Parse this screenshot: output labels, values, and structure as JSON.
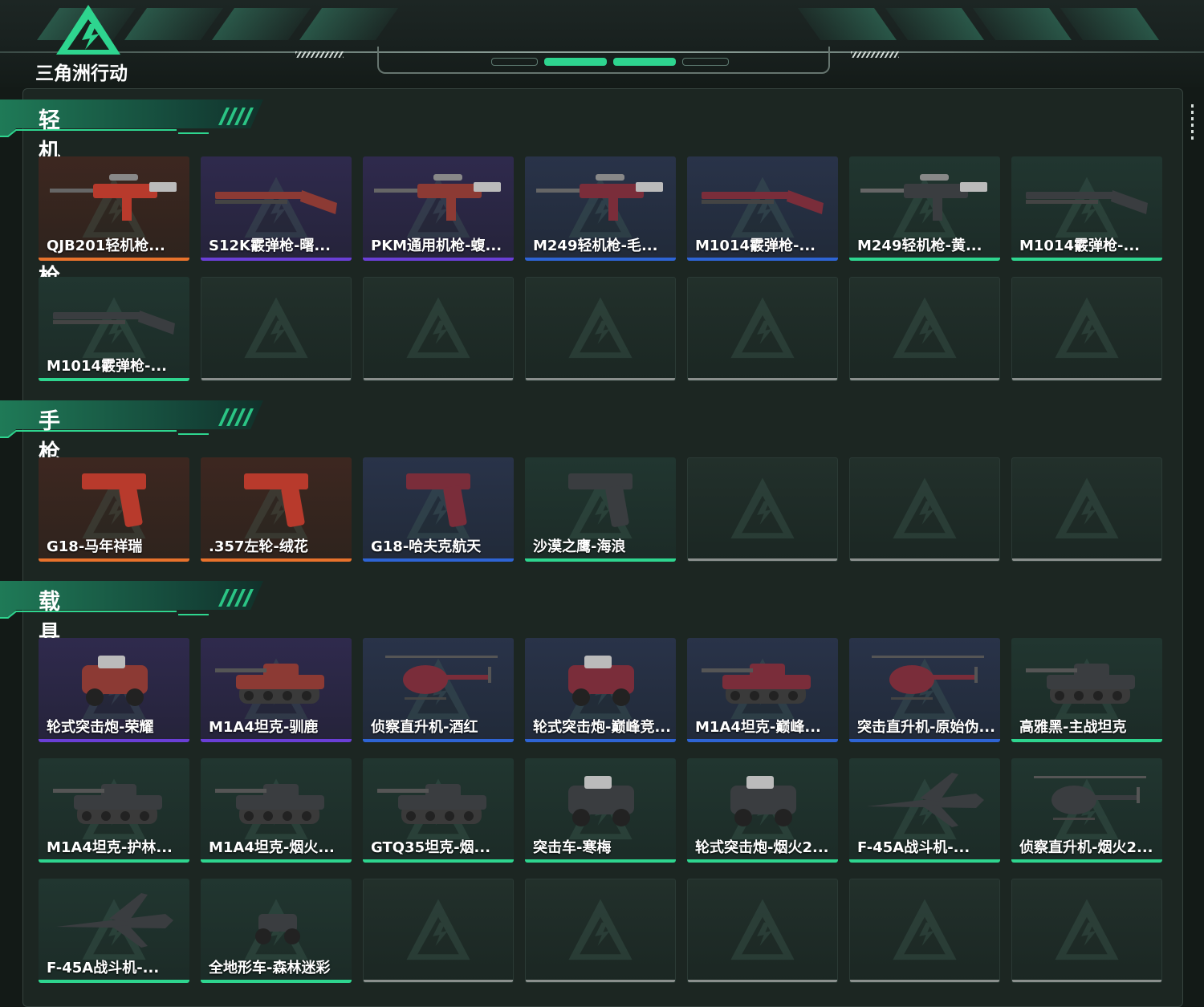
{
  "brand": {
    "logo_text": "三角洲行动",
    "accent": "#2ed58f"
  },
  "rarity_colors": {
    "orange": "#e8722c",
    "purple": "#6a3fd6",
    "blue": "#2e64d4",
    "green": "#2ed58f",
    "empty": "#8a8f8d"
  },
  "sections": [
    {
      "title": "轻机枪/霰弹枪",
      "items": [
        {
          "name": "QJB201轻机枪...",
          "rarity": "orange",
          "icon": "lmg-icon"
        },
        {
          "name": "S12K霰弹枪-曙...",
          "rarity": "purple",
          "icon": "shotgun-icon"
        },
        {
          "name": "PKM通用机枪-蝮...",
          "rarity": "purple",
          "icon": "machine-gun-icon"
        },
        {
          "name": "M249轻机枪-毛...",
          "rarity": "blue",
          "icon": "lmg-icon"
        },
        {
          "name": "M1014霰弹枪-...",
          "rarity": "blue",
          "icon": "shotgun-icon"
        },
        {
          "name": "M249轻机枪-黄...",
          "rarity": "green",
          "icon": "lmg-icon"
        },
        {
          "name": "M1014霰弹枪-...",
          "rarity": "green",
          "icon": "shotgun-icon"
        },
        {
          "name": "M1014霰弹枪-...",
          "rarity": "green",
          "icon": "shotgun-icon"
        }
      ],
      "empty_slots": 6
    },
    {
      "title": "手枪",
      "items": [
        {
          "name": "G18-马年祥瑞",
          "rarity": "orange",
          "icon": "pistol-icon"
        },
        {
          "name": ".357左轮-绒花",
          "rarity": "orange",
          "icon": "revolver-icon"
        },
        {
          "name": "G18-哈夫克航天",
          "rarity": "blue",
          "icon": "pistol-icon"
        },
        {
          "name": "沙漠之鹰-海浪",
          "rarity": "green",
          "icon": "pistol-icon"
        }
      ],
      "empty_slots": 3
    },
    {
      "title": "载具外观",
      "items": [
        {
          "name": "轮式突击炮-荣耀",
          "rarity": "purple",
          "icon": "armored-car-icon"
        },
        {
          "name": "M1A4坦克-驯鹿",
          "rarity": "purple",
          "icon": "tank-icon"
        },
        {
          "name": "侦察直升机-酒红",
          "rarity": "blue",
          "icon": "helicopter-icon"
        },
        {
          "name": "轮式突击炮-巅峰竞...",
          "rarity": "blue",
          "icon": "armored-car-icon"
        },
        {
          "name": "M1A4坦克-巅峰...",
          "rarity": "blue",
          "icon": "tank-icon"
        },
        {
          "name": "突击直升机-原始伪...",
          "rarity": "blue",
          "icon": "attack-helicopter-icon"
        },
        {
          "name": "高雅黑-主战坦克",
          "rarity": "green",
          "icon": "tank-icon"
        },
        {
          "name": "M1A4坦克-护林...",
          "rarity": "green",
          "icon": "tank-icon"
        },
        {
          "name": "M1A4坦克-烟火...",
          "rarity": "green",
          "icon": "tank-icon"
        },
        {
          "name": "GTQ35坦克-烟...",
          "rarity": "green",
          "icon": "tank-icon"
        },
        {
          "name": "突击车-寒梅",
          "rarity": "green",
          "icon": "assault-vehicle-icon"
        },
        {
          "name": "轮式突击炮-烟火2...",
          "rarity": "green",
          "icon": "armored-car-icon"
        },
        {
          "name": "F-45A战斗机-...",
          "rarity": "green",
          "icon": "fighter-jet-icon"
        },
        {
          "name": "侦察直升机-烟火2...",
          "rarity": "green",
          "icon": "helicopter-icon"
        },
        {
          "name": "F-45A战斗机-...",
          "rarity": "green",
          "icon": "fighter-jet-icon"
        },
        {
          "name": "全地形车-森林迷彩",
          "rarity": "green",
          "icon": "atv-icon"
        }
      ],
      "empty_slots": 5
    }
  ]
}
